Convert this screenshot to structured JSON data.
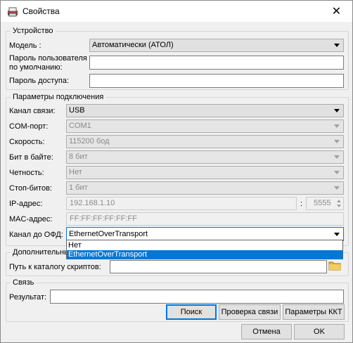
{
  "window": {
    "title": "Свойства",
    "icon": "printer-icon",
    "close_glyph": "✕"
  },
  "device": {
    "legend": "Устройство",
    "model_label": "Модель :",
    "model_value": "Автоматически (АТОЛ)",
    "user_password_label_line1": "Пароль пользователя",
    "user_password_label_line2": "по умолчанию:",
    "user_password_value": "",
    "access_password_label": "Пароль доступа:",
    "access_password_value": ""
  },
  "connection": {
    "legend": "Параметры подключения",
    "channel_label": "Канал связи:",
    "channel_value": "USB",
    "com_port_label": "COM-порт:",
    "com_port_value": "COM1",
    "speed_label": "Скорость:",
    "speed_value": "115200 бод",
    "bits_label": "Бит в байте:",
    "bits_value": "8 бит",
    "parity_label": "Четность:",
    "parity_value": "Нет",
    "stop_bits_label": "Стоп-битов:",
    "stop_bits_value": "1 бит",
    "ip_label": "IP-адрес:",
    "ip_value": "192.168.1.10",
    "port_separator": ":",
    "port_value": "5555",
    "mac_label": "MAC-адрес:",
    "mac_value": "FF:FF:FF:FF:FF:FF",
    "ofd_channel_label": "Канал до ОФД:",
    "ofd_channel_value": "EthernetOverTransport",
    "ofd_options": [
      "Нет",
      "EthernetOverTransport"
    ]
  },
  "additional": {
    "legend": "Дополнительные",
    "scripts_path_label": "Путь к каталогу скриптов:",
    "scripts_path_value": ""
  },
  "link": {
    "legend": "Связь",
    "result_label": "Результат:",
    "result_value": "",
    "search_button": "Поиск",
    "check_button": "Проверка связи",
    "kkt_params_button": "Параметры ККТ"
  },
  "footer": {
    "cancel_button": "Отмена",
    "ok_button": "OK"
  },
  "colors": {
    "accent": "#0078d7",
    "window_bg": "#f0f0f0",
    "disabled_text": "#8a8a8a"
  }
}
